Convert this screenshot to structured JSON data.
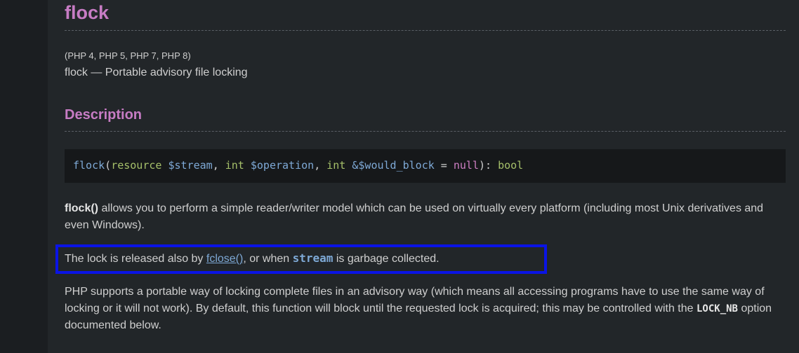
{
  "page": {
    "title": "flock",
    "versions": "(PHP 4, PHP 5, PHP 7, PHP 8)",
    "refname": "flock — Portable advisory file locking",
    "description_heading": "Description"
  },
  "signature": {
    "function": "flock",
    "open_paren": "(",
    "p1_type": "resource",
    "p1_name": "$stream",
    "comma1": ", ",
    "p2_type": "int",
    "p2_name": "$operation",
    "comma2": ", ",
    "p3_type": "int",
    "p3_name": "&$would_block",
    "equals": " = ",
    "default": "null",
    "close": "): ",
    "return_type": "bool"
  },
  "para1": {
    "fn": "flock()",
    "text": " allows you to perform a simple reader/writer model which can be used on virtually every platform (including most Unix derivatives and even Windows)."
  },
  "para2": {
    "before": "The lock is released also by ",
    "link": "fclose()",
    "middle": ", or when ",
    "param": "stream",
    "after": " is garbage collected."
  },
  "para3": {
    "text": "PHP supports a portable way of locking complete files in an advisory way (which means all accessing programs have to use the same way of locking or it will not work). By default, this function will block until the requested lock is acquired; this may be controlled with the ",
    "const": "LOCK_NB",
    "after": " option documented below."
  },
  "colors": {
    "accent_heading": "#c77cc4",
    "highlight_box": "#0a14e6",
    "background": "#222629"
  }
}
